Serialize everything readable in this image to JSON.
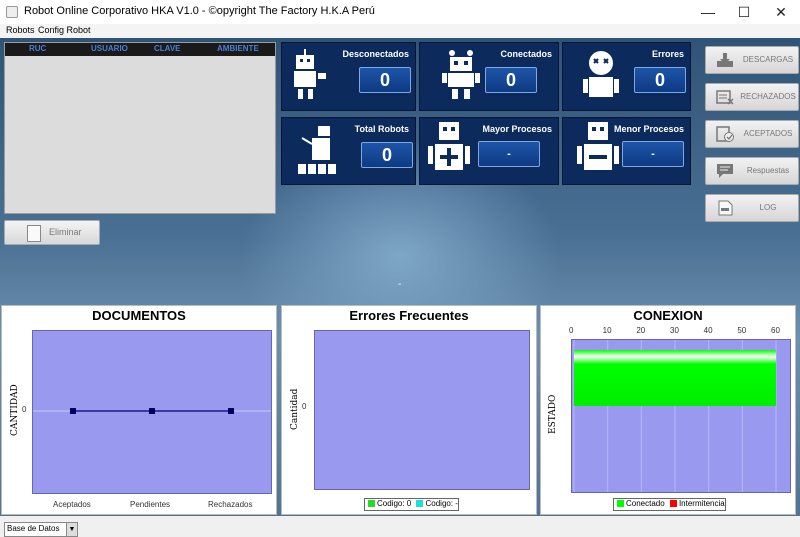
{
  "window": {
    "title": "Robot Online Corporativo HKA V1.0  - ©opyright The Factory H.K.A Perú",
    "minimize": "—",
    "maximize": "☐",
    "close": "✕"
  },
  "menu": [
    "Robots",
    "Config Robot"
  ],
  "grid": {
    "columns": [
      "RUC",
      "USUARIO",
      "CLAVE",
      "AMBIENTE"
    ],
    "rows": []
  },
  "eliminar_label": "Eliminar",
  "cards": {
    "desconectados": {
      "label": "Desconectados",
      "value": "0"
    },
    "conectados": {
      "label": "Conectados",
      "value": "0"
    },
    "errores": {
      "label": "Errores",
      "value": "0"
    },
    "total_robots": {
      "label": "Total Robots",
      "value": "0"
    },
    "mayor_procesos": {
      "label": "Mayor Procesos",
      "value": "-"
    },
    "menor_procesos": {
      "label": "Menor Procesos",
      "value": "-"
    }
  },
  "side_buttons": {
    "descargas": "DESCARGAS",
    "rechazados": "RECHAZADOS",
    "aceptados": "ACEPTADOS",
    "respuestas": "Respuestas",
    "log": "LOG"
  },
  "center_mark": "-",
  "chart_data": [
    {
      "type": "line",
      "title": "DOCUMENTOS",
      "ylabel": "CANTIDAD",
      "categories": [
        "Aceptados",
        "Pendientes",
        "Rechazados"
      ],
      "values": [
        0,
        0,
        0
      ],
      "yticks": [
        "0"
      ]
    },
    {
      "type": "bar",
      "title": "Errores Frecuentes",
      "ylabel": "Cantidad",
      "yticks": [
        "0"
      ],
      "legend": [
        {
          "name": "Codigo: 0",
          "color": "#22dd22"
        },
        {
          "name": "Codigo: -",
          "color": "#22dddd"
        }
      ]
    },
    {
      "type": "bar",
      "title": "CONEXION",
      "ylabel": "ESTADO",
      "xticks": [
        "0",
        "10",
        "20",
        "30",
        "40",
        "50",
        "60"
      ],
      "xlim": [
        0,
        60
      ],
      "series": [
        {
          "name": "Conectado",
          "value": 60,
          "color": "#00ff00"
        }
      ],
      "legend": [
        {
          "name": "Conectado",
          "color": "#00ff00"
        },
        {
          "name": "Intermitencia",
          "color": "#ff0000"
        }
      ]
    }
  ],
  "database_select": {
    "value": "Base de Datos",
    "arrow": "▼"
  }
}
